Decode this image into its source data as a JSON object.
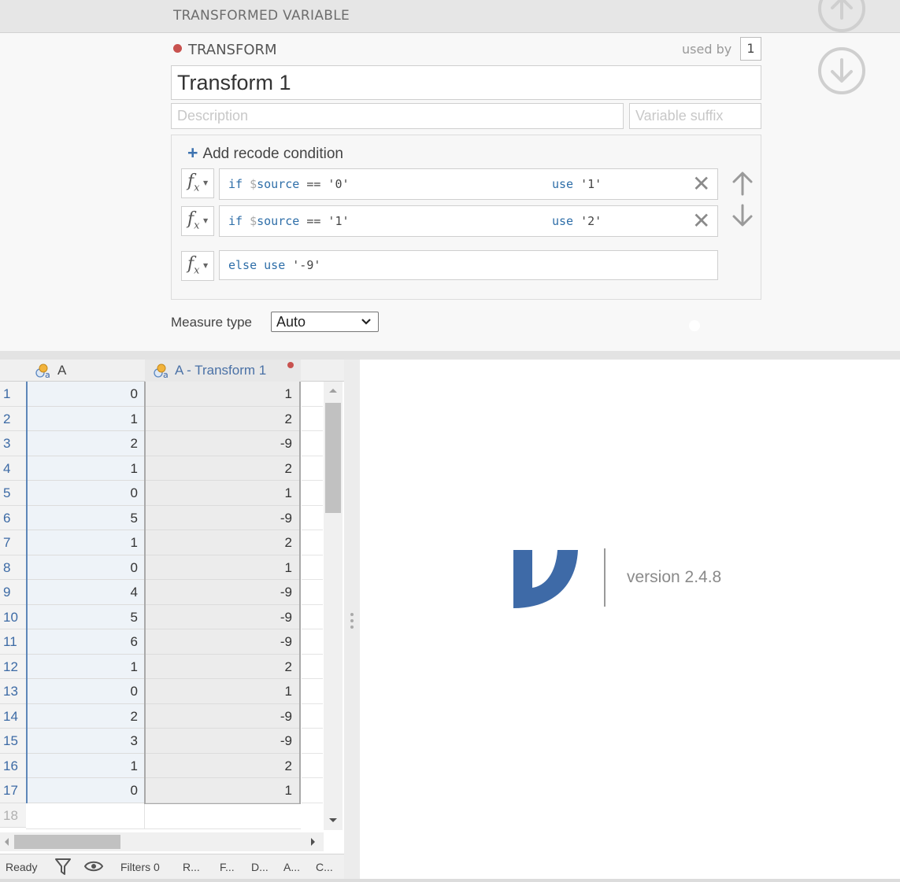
{
  "editor": {
    "panel_title": "TRANSFORMED VARIABLE",
    "section_label": "TRANSFORM",
    "used_by_label": "used by",
    "used_by_count": "1",
    "name": "Transform 1",
    "description_placeholder": "Description",
    "suffix_placeholder": "Variable suffix",
    "add_condition_label": "Add recode condition",
    "conditions": [
      {
        "if": "if",
        "var": "source",
        "op": "== '0'",
        "use": "use",
        "value": "'1'"
      },
      {
        "if": "if",
        "var": "source",
        "op": "== '1'",
        "use": "use",
        "value": "'2'"
      }
    ],
    "else_keyword": "else use",
    "else_value": "'-9'",
    "measure_type_label": "Measure type",
    "measure_type_value": "Auto",
    "icons": [
      "arrow-up-circle-icon",
      "arrow-down-circle-icon",
      "fx-icon",
      "close-icon",
      "arrow-up-icon",
      "arrow-down-icon",
      "plus-icon",
      "chevron-down-icon"
    ],
    "dot_color": "#c8524f",
    "accent_color": "#3e73b0"
  },
  "spreadsheet": {
    "columns": [
      {
        "name": "A",
        "icon": "nominal-variable-icon"
      },
      {
        "name": "A - Transform 1",
        "icon": "nominal-variable-icon"
      }
    ],
    "row_numbers": [
      "1",
      "2",
      "3",
      "4",
      "5",
      "6",
      "7",
      "8",
      "9",
      "10",
      "11",
      "12",
      "13",
      "14",
      "15",
      "16",
      "17"
    ],
    "empty_row_number": "18",
    "col_a": [
      "0",
      "1",
      "2",
      "1",
      "0",
      "5",
      "1",
      "0",
      "4",
      "5",
      "6",
      "1",
      "0",
      "2",
      "3",
      "1",
      "0"
    ],
    "col_transform": [
      "1",
      "2",
      "-9",
      "2",
      "1",
      "-9",
      "2",
      "1",
      "-9",
      "-9",
      "-9",
      "2",
      "1",
      "-9",
      "-9",
      "2",
      "1"
    ]
  },
  "status_bar": {
    "ready": "Ready",
    "filters": "Filters 0",
    "items": [
      "R...",
      "F...",
      "D...",
      "A...",
      "C..."
    ],
    "icons": [
      "filter-icon",
      "eye-icon"
    ]
  },
  "results": {
    "version": "version 2.4.8",
    "logo_color": "#3e6aa7"
  }
}
